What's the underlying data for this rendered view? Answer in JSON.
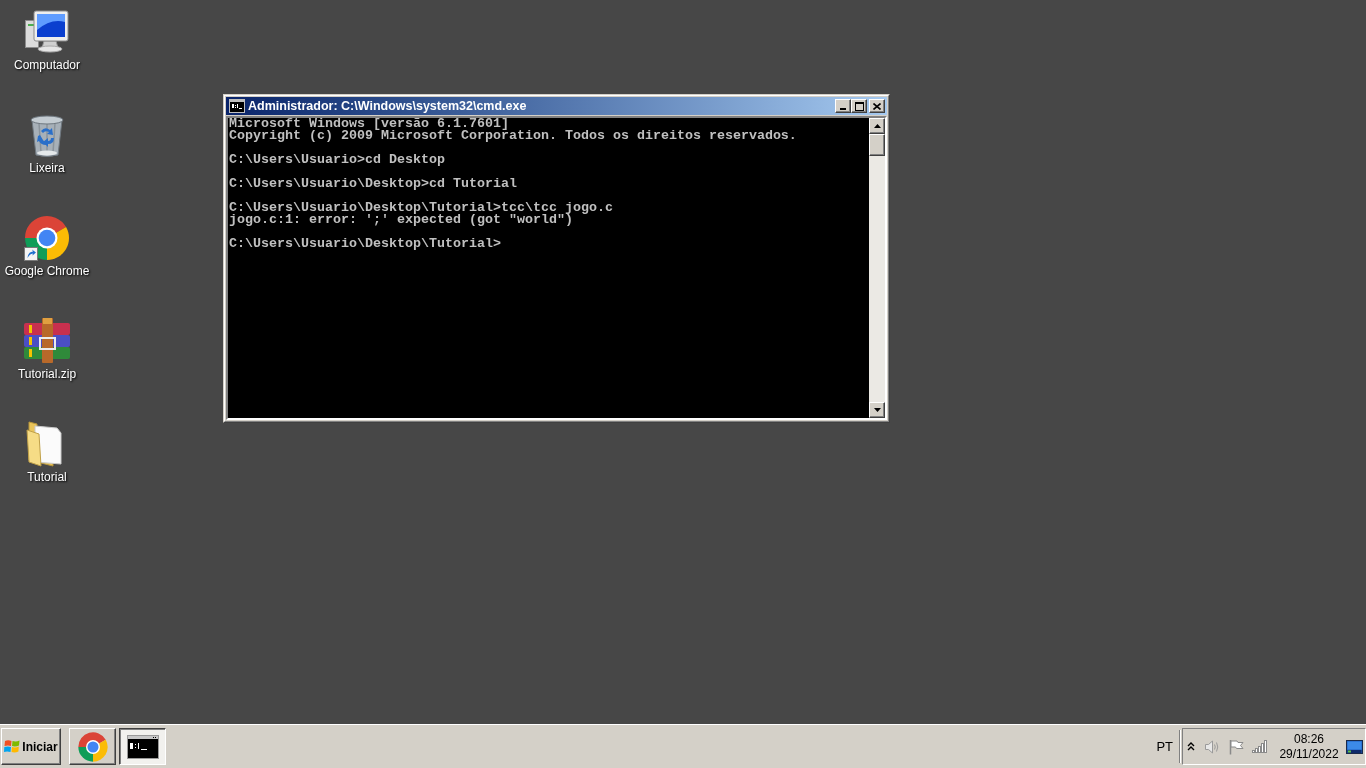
{
  "desktop": {
    "icons": [
      {
        "label": "Computador",
        "kind": "computer"
      },
      {
        "label": "Lixeira",
        "kind": "recycle_bin"
      },
      {
        "label": "Google Chrome",
        "kind": "chrome_shortcut"
      },
      {
        "label": "Tutorial.zip",
        "kind": "archive"
      },
      {
        "label": "Tutorial",
        "kind": "folder"
      }
    ]
  },
  "window": {
    "title": "Administrador: C:\\Windows\\system32\\cmd.exe",
    "console_blocks": [
      [
        "Microsoft Windows [versão 6.1.7601]",
        "Copyright (c) 2009 Microsoft Corporation. Todos os direitos reservados."
      ],
      [
        "C:\\Users\\Usuario>cd Desktop"
      ],
      [
        "C:\\Users\\Usuario\\Desktop>cd Tutorial"
      ],
      [
        "C:\\Users\\Usuario\\Desktop\\Tutorial>tcc\\tcc jogo.c",
        "jogo.c:1: error: ';' expected (got \"world\")"
      ],
      [
        "C:\\Users\\Usuario\\Desktop\\Tutorial>"
      ]
    ]
  },
  "taskbar": {
    "start_button": "Iniciar",
    "buttons": [
      {
        "kind": "chrome",
        "selected": false
      },
      {
        "kind": "console",
        "selected": true
      }
    ],
    "language": "PT",
    "clock": {
      "time": "08:26",
      "date": "29/11/2022"
    }
  }
}
